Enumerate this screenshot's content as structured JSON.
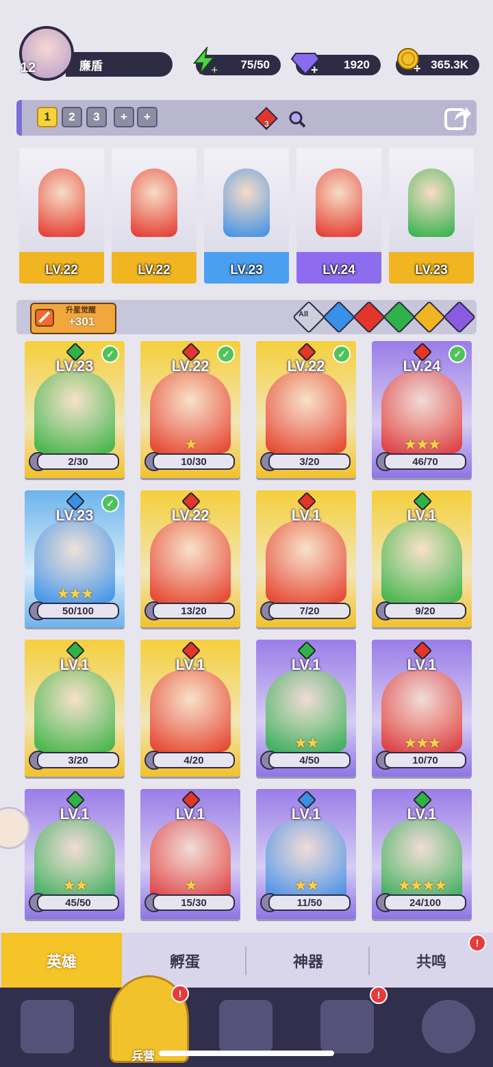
{
  "player": {
    "level": "12",
    "name": "廉盾"
  },
  "resources": {
    "energy": {
      "value": "75/50",
      "icon": "lightning-icon",
      "color": "#4fd24a"
    },
    "gems": {
      "value": "1920",
      "icon": "diamond-icon",
      "color": "#8a6bf0"
    },
    "gold": {
      "value": "365.3K",
      "icon": "coin-icon",
      "color": "#f4c02a"
    }
  },
  "team_tabs": [
    "1",
    "2",
    "3",
    "+",
    "+"
  ],
  "team_badge": "3",
  "lineup": [
    {
      "level": "LV.22",
      "band_color": "#f0b520",
      "element": "fire"
    },
    {
      "level": "LV.22",
      "band_color": "#f0b520",
      "element": "fire"
    },
    {
      "level": "LV.23",
      "band_color": "#4b9ff0",
      "element": "water"
    },
    {
      "level": "LV.24",
      "band_color": "#8d6cf0",
      "element": "fire"
    },
    {
      "level": "LV.23",
      "band_color": "#f0b520",
      "element": "wind"
    }
  ],
  "star_button": {
    "label": "升星觉醒",
    "count": "+301"
  },
  "filters": [
    {
      "label": "All",
      "color": "#cfcfdc"
    },
    {
      "label": "",
      "color": "#3a8fe8"
    },
    {
      "label": "",
      "color": "#e4352b"
    },
    {
      "label": "",
      "color": "#2fb24a"
    },
    {
      "label": "",
      "color": "#f0b520"
    },
    {
      "label": "",
      "color": "#8a5be0"
    }
  ],
  "heroes": [
    {
      "level": "LV.23",
      "progress": "2/30",
      "rarity": "gold",
      "element": "wind",
      "checked": true,
      "stars": ""
    },
    {
      "level": "LV.22",
      "progress": "10/30",
      "rarity": "gold",
      "element": "fire",
      "checked": true,
      "stars": "★"
    },
    {
      "level": "LV.22",
      "progress": "3/20",
      "rarity": "gold",
      "element": "fire",
      "checked": true,
      "stars": ""
    },
    {
      "level": "LV.24",
      "progress": "46/70",
      "rarity": "purple",
      "element": "fire",
      "checked": true,
      "stars": "★★★"
    },
    {
      "level": "LV.23",
      "progress": "50/100",
      "rarity": "blue",
      "element": "water",
      "checked": true,
      "stars": "★★★"
    },
    {
      "level": "LV.22",
      "progress": "13/20",
      "rarity": "gold",
      "element": "fire",
      "checked": false,
      "stars": ""
    },
    {
      "level": "LV.1",
      "progress": "7/20",
      "rarity": "gold",
      "element": "fire",
      "checked": false,
      "stars": ""
    },
    {
      "level": "LV.1",
      "progress": "9/20",
      "rarity": "gold",
      "element": "wind",
      "checked": false,
      "stars": ""
    },
    {
      "level": "LV.1",
      "progress": "3/20",
      "rarity": "gold",
      "element": "wind",
      "checked": false,
      "stars": ""
    },
    {
      "level": "LV.1",
      "progress": "4/20",
      "rarity": "gold",
      "element": "fire",
      "checked": false,
      "stars": ""
    },
    {
      "level": "LV.1",
      "progress": "4/50",
      "rarity": "purple",
      "element": "wind",
      "checked": false,
      "stars": "★★"
    },
    {
      "level": "LV.1",
      "progress": "10/70",
      "rarity": "purple",
      "element": "fire",
      "checked": false,
      "stars": "★★★"
    },
    {
      "level": "LV.1",
      "progress": "45/50",
      "rarity": "purple",
      "element": "wind",
      "checked": false,
      "stars": "★★"
    },
    {
      "level": "LV.1",
      "progress": "15/30",
      "rarity": "purple",
      "element": "fire",
      "checked": false,
      "stars": "★"
    },
    {
      "level": "LV.1",
      "progress": "11/50",
      "rarity": "purple",
      "element": "water",
      "checked": false,
      "stars": "★★"
    },
    {
      "level": "LV.1",
      "progress": "24/100",
      "rarity": "purple",
      "element": "wind",
      "checked": false,
      "stars": "★★★★"
    }
  ],
  "bottom_tabs": {
    "heroes": "英雄",
    "hatch": "孵蛋",
    "artifact": "神器",
    "resonance": "共鸣"
  },
  "nav": {
    "barracks": "兵营",
    "badge": "!"
  },
  "colors": {
    "gold": "#f2c22c",
    "purple": "#8f74e6",
    "blue": "#6cb4ec",
    "fire": "#e4352b",
    "water": "#3a8fe8",
    "wind": "#2fb24a"
  }
}
